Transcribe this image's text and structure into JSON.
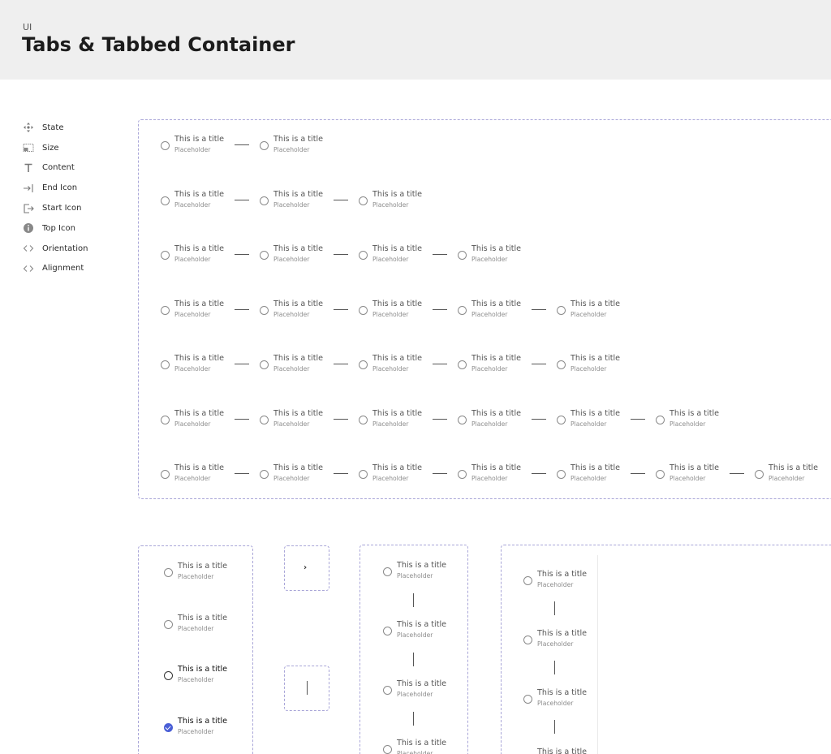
{
  "header": {
    "breadcrumb": "UI",
    "title": "Tabs & Tabbed Container"
  },
  "legend": [
    {
      "icon": "move-icon",
      "label": "State"
    },
    {
      "icon": "size-icon",
      "label": "Size"
    },
    {
      "icon": "text-icon",
      "label": "Content"
    },
    {
      "icon": "end-icon",
      "label": "End Icon"
    },
    {
      "icon": "start-icon",
      "label": "Start Icon"
    },
    {
      "icon": "info-icon",
      "label": "Top Icon"
    },
    {
      "icon": "code-icon",
      "label": "Orientation"
    },
    {
      "icon": "code-icon",
      "label": "Alignment"
    }
  ],
  "step": {
    "title": "This is a title",
    "placeholder": "Placeholder"
  },
  "rows": [
    2,
    3,
    4,
    5,
    5,
    6,
    7
  ],
  "column_a_states": [
    "default",
    "default",
    "hover",
    "checked"
  ],
  "chevron": "›",
  "colors": {
    "accent": "#4a5fd6",
    "frame_border": "#a9a6d8",
    "header_bg": "#efefef"
  }
}
